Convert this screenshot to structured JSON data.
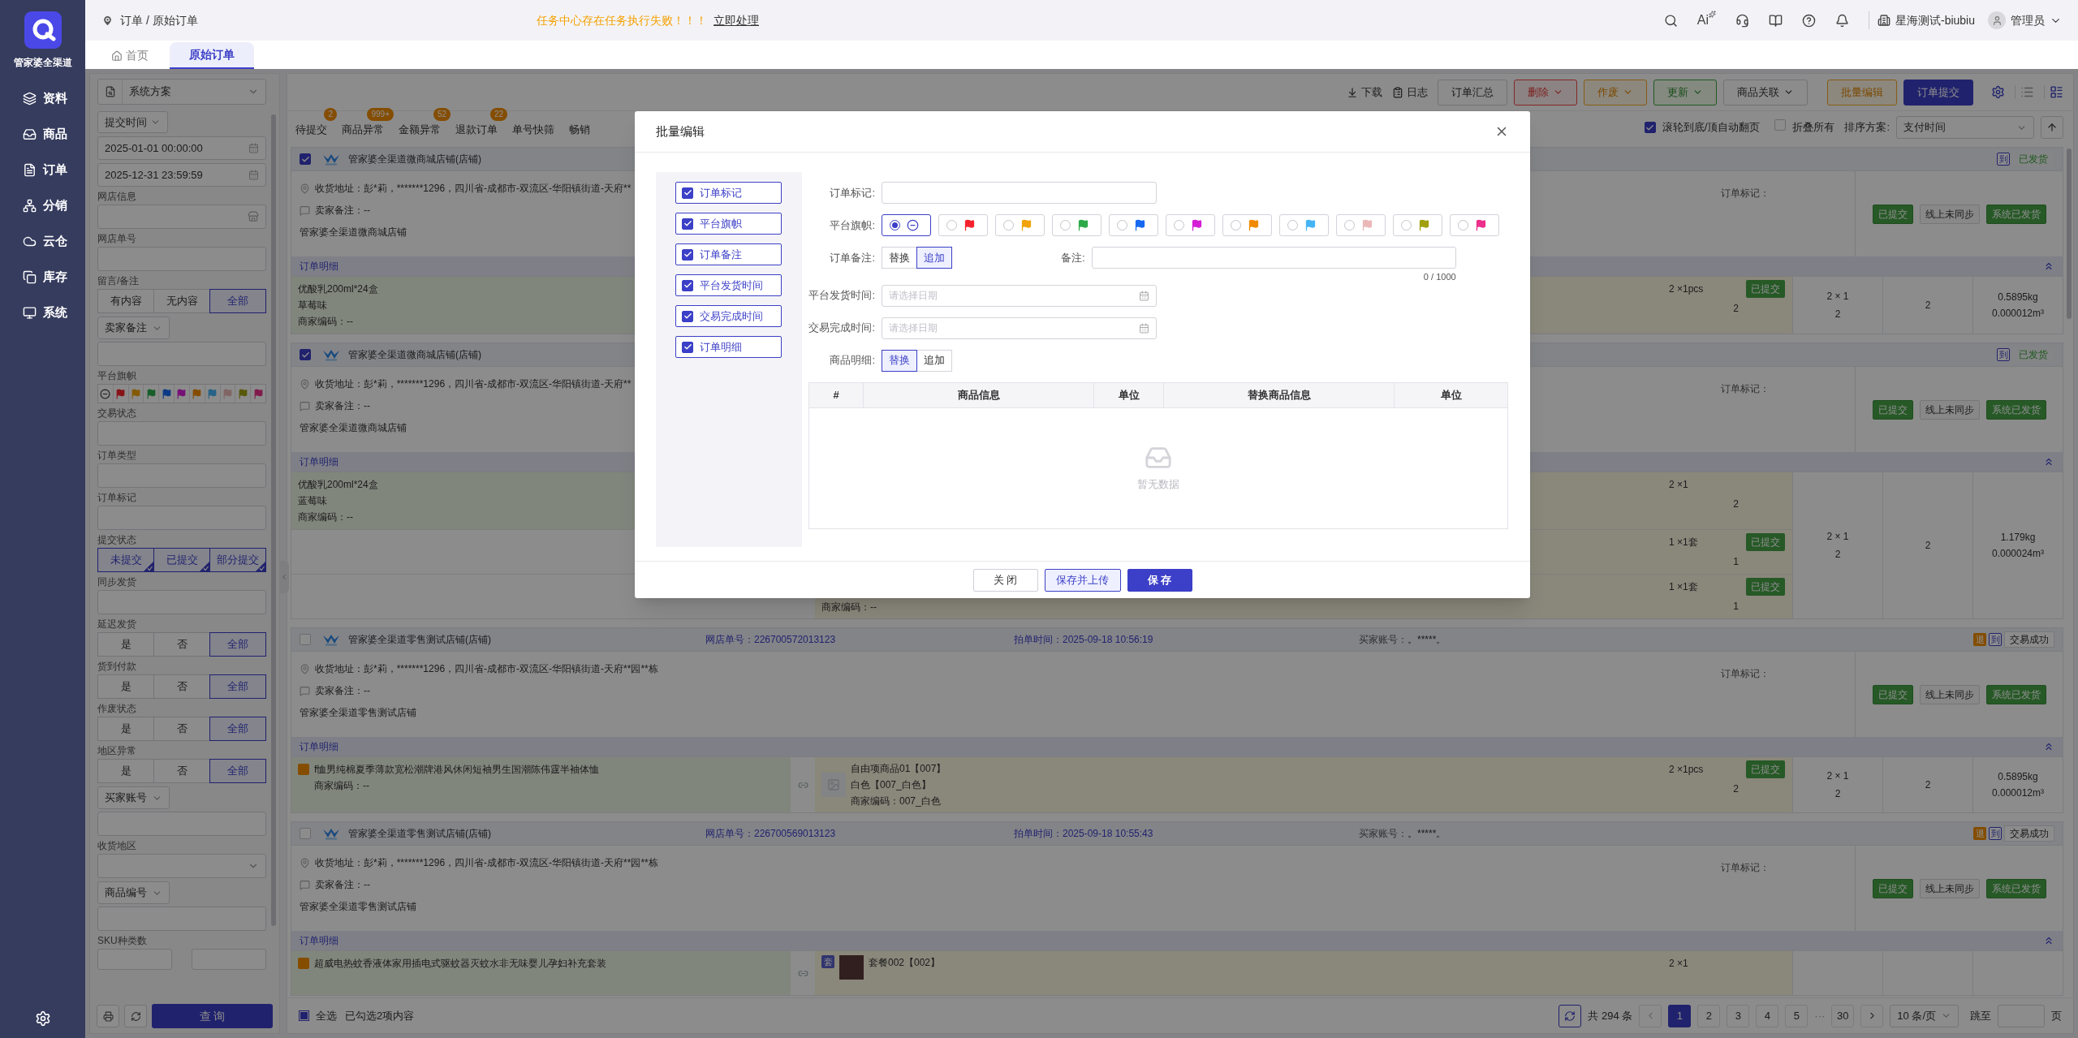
{
  "app": {
    "name": "管家婆全渠道"
  },
  "nav": [
    {
      "label": "资料"
    },
    {
      "label": "商品"
    },
    {
      "label": "订单"
    },
    {
      "label": "分销"
    },
    {
      "label": "云仓"
    },
    {
      "label": "库存"
    },
    {
      "label": "系统"
    }
  ],
  "topbar": {
    "breadcrumb": "订单 / 原始订单",
    "alert": "任务中心存在任务执行失败！！！",
    "alert_action": "立即处理",
    "ai_label": "Ai",
    "company": "星海测试-biubiu",
    "user": "管理员"
  },
  "page_tabs": [
    {
      "label": "首页",
      "selected": false
    },
    {
      "label": "原始订单",
      "selected": true
    }
  ],
  "filters": {
    "scheme": "系统方案",
    "time_type": "提交时间",
    "start": "2025-01-01 00:00:00",
    "end": "2025-12-31 23:59:59",
    "groups": [
      {
        "kind": "store",
        "label": "网店信息"
      },
      {
        "kind": "input",
        "label": "网店单号"
      },
      {
        "kind": "segment",
        "label": "留言/备注",
        "options": [
          {
            "label": "有内容",
            "selected": false
          },
          {
            "label": "无内容",
            "selected": false
          },
          {
            "label": "全部",
            "selected": true
          }
        ]
      },
      {
        "kind": "dropdown",
        "label": "卖家备注"
      },
      {
        "kind": "flags",
        "label": "平台旗帜",
        "flags": [
          {
            "kind": "none"
          },
          {
            "kind": "flag",
            "color": "#871319"
          },
          {
            "kind": "flag",
            "color": "#845a06"
          },
          {
            "kind": "flag",
            "color": "#195e29"
          },
          {
            "kind": "flag",
            "color": "#0c3984"
          },
          {
            "kind": "flag",
            "color": "#761176"
          },
          {
            "kind": "flag",
            "color": "#844c00"
          },
          {
            "kind": "flag",
            "color": "#266387"
          },
          {
            "kind": "flag",
            "color": "#816565"
          },
          {
            "kind": "flag",
            "color": "#585809"
          },
          {
            "kind": "flag",
            "color": "#811a4c"
          }
        ]
      },
      {
        "kind": "input",
        "label": "交易状态"
      },
      {
        "kind": "input",
        "label": "订单类型"
      },
      {
        "kind": "input",
        "label": "订单标记"
      },
      {
        "kind": "multi",
        "label": "提交状态",
        "options": [
          {
            "label": "未提交",
            "selected": true
          },
          {
            "label": "已提交",
            "selected": true
          },
          {
            "label": "部分提交",
            "selected": true
          }
        ]
      },
      {
        "kind": "input",
        "label": "同步发货"
      },
      {
        "kind": "segment",
        "label": "延迟发货",
        "options": [
          {
            "label": "是",
            "selected": false
          },
          {
            "label": "否",
            "selected": false
          },
          {
            "label": "全部",
            "selected": true
          }
        ]
      },
      {
        "kind": "segment",
        "label": "货到付款",
        "options": [
          {
            "label": "是",
            "selected": false
          },
          {
            "label": "否",
            "selected": false
          },
          {
            "label": "全部",
            "selected": true
          }
        ]
      },
      {
        "kind": "segment",
        "label": "作废状态",
        "options": [
          {
            "label": "是",
            "selected": false
          },
          {
            "label": "否",
            "selected": false
          },
          {
            "label": "全部",
            "selected": true
          }
        ]
      },
      {
        "kind": "segment",
        "label": "地区异常",
        "options": [
          {
            "label": "是",
            "selected": false
          },
          {
            "label": "否",
            "selected": false
          },
          {
            "label": "全部",
            "selected": true
          }
        ]
      },
      {
        "kind": "dropdown",
        "label": "买家账号"
      },
      {
        "kind": "select",
        "label": "收货地区"
      },
      {
        "kind": "dropdown",
        "label": "商品编号"
      },
      {
        "kind": "range",
        "label": "SKU种类数"
      }
    ],
    "query": "查 询"
  },
  "toolbar": {
    "links": [
      {
        "label": "下载"
      },
      {
        "label": "日志"
      }
    ],
    "buttons": [
      {
        "label": "订单汇总",
        "kind": "plain",
        "caret": false
      },
      {
        "label": "删除",
        "kind": "red",
        "caret": true
      },
      {
        "label": "作废",
        "kind": "orange",
        "caret": true
      },
      {
        "label": "更新",
        "kind": "green",
        "caret": true
      },
      {
        "label": "商品关联",
        "kind": "plain",
        "caret": true
      },
      {
        "label": "批量编辑",
        "kind": "orange",
        "caret": false
      },
      {
        "label": "订单提交",
        "kind": "primary",
        "caret": false
      }
    ],
    "views": [
      {
        "kind": "list",
        "selected": false
      },
      {
        "kind": "card",
        "selected": true
      }
    ]
  },
  "status_tabs": [
    {
      "label": "待提交",
      "count": "2"
    },
    {
      "label": "商品异常",
      "count": "999+"
    },
    {
      "label": "金额异常",
      "count": "52"
    },
    {
      "label": "退款订单",
      "count": "22"
    },
    {
      "label": "单号快筛"
    },
    {
      "label": "畅销"
    }
  ],
  "list_options": {
    "auto_page": {
      "label": "滚轮到底/顶自动翻页",
      "checked": true
    },
    "collapse_all": {
      "label": "折叠所有",
      "checked": false
    },
    "sort_label": "排序方案:",
    "sort_value": "支付时间"
  },
  "orders": [
    {
      "checked": true,
      "shop": "管家婆全渠道微商城店铺(店铺)",
      "badges": [
        {
          "text": "到",
          "kind": "outline"
        }
      ],
      "status": {
        "text": "已发货",
        "kind": "shipped"
      },
      "address": "收货地址：彭*莉，*******1296，四川省-成都市-双流区-华阳镇街道-天府**",
      "note": "卖家备注：--",
      "shop_line": "管家婆全渠道微商城店铺",
      "mark_label": "订单标记：",
      "actions": [
        {
          "label": "已提交",
          "kind": "green"
        },
        {
          "label": "线上未同步",
          "kind": "plain"
        },
        {
          "label": "系统已发货",
          "kind": "green"
        }
      ],
      "detail": "订单明细",
      "rows": [
        {
          "product": {
            "tagged": false,
            "lines": [
              "优酸乳200ml*24盒",
              "草莓味",
              "商家编码：--"
            ]
          },
          "right": null,
          "qty": "2 ×1pcs",
          "count": "2",
          "state": "已提交"
        }
      ],
      "totals": {
        "qty": "2 × 1",
        "count": "2",
        "sum": "2",
        "weight": "0.5895kg",
        "volume": "0.000012m³"
      }
    },
    {
      "checked": true,
      "shop": "管家婆全渠道微商城店铺(店铺)",
      "badges": [
        {
          "text": "到",
          "kind": "outline"
        }
      ],
      "status": {
        "text": "已发货",
        "kind": "shipped"
      },
      "address": "收货地址：彭*莉，*******1296，四川省-成都市-双流区-华阳镇街道-天府**",
      "note": "卖家备注：--",
      "shop_line": "管家婆全渠道微商城店铺",
      "mark_label": "订单标记：",
      "actions": [
        {
          "label": "已提交",
          "kind": "green"
        },
        {
          "label": "线上未同步",
          "kind": "plain"
        },
        {
          "label": "系统已发货",
          "kind": "green"
        }
      ],
      "detail": "订单明细",
      "rows": [
        {
          "product": {
            "tagged": false,
            "lines": [
              "优酸乳200ml*24盒",
              "蓝莓味",
              "商家编码：--"
            ]
          },
          "right": null,
          "qty": "2 ×1",
          "count": "2"
        },
        {
          "product": null,
          "right": null,
          "qty": "1 ×1套",
          "count": "1",
          "state": "已提交"
        },
        {
          "product": null,
          "right": {
            "lines": [
              "商家编码：--"
            ]
          },
          "qty": "1 ×1套",
          "count": "1",
          "state": "已提交"
        }
      ],
      "totals": {
        "qty": "2 × 1",
        "count": "2",
        "sum": "2",
        "weight": "1.179kg",
        "volume": "0.000024m³"
      }
    },
    {
      "checked": false,
      "shop": "管家婆全渠道零售测试店铺(店铺)",
      "fields": [
        {
          "label": "网店单号：",
          "value": "226700572013123",
          "accent": true
        },
        {
          "label": "拍单时间：",
          "value": "2025-09-18 10:56:19",
          "accent": true
        },
        {
          "label": "买家账号：",
          "value": "。*****。",
          "accent": false
        }
      ],
      "badges": [
        {
          "text": "退",
          "kind": "filled"
        },
        {
          "text": "到",
          "kind": "outline"
        }
      ],
      "status": {
        "text": "交易成功",
        "kind": "done"
      },
      "address": "收货地址：彭*莉，*******1296，四川省-成都市-双流区-华阳镇街道-天府**园**栋",
      "note": "卖家备注：--",
      "shop_line": "管家婆全渠道零售测试店铺",
      "mark_label": "订单标记：",
      "actions": [
        {
          "label": "已提交",
          "kind": "green"
        },
        {
          "label": "线上未同步",
          "kind": "plain"
        },
        {
          "label": "系统已发货",
          "kind": "green"
        }
      ],
      "detail": "订单明细",
      "rows": [
        {
          "product": {
            "tagged": true,
            "lines": [
              "f恤男纯棉夏季薄款宽松潮牌港风休闲短袖男生国潮陈伟霆半袖体恤",
              "商家编码：--"
            ]
          },
          "right": {
            "kind": "placeholder",
            "lines": [
              "自由项商品01【007】",
              "白色【007_白色】",
              "商家编码：007_白色"
            ]
          },
          "qty": "2 ×1pcs",
          "count": "2",
          "state": "已提交"
        }
      ],
      "totals": {
        "qty": "2 × 1",
        "count": "2",
        "sum": "2",
        "weight": "0.5895kg",
        "volume": "0.000012m³"
      }
    },
    {
      "checked": false,
      "shop": "管家婆全渠道零售测试店铺(店铺)",
      "fields": [
        {
          "label": "网店单号：",
          "value": "226700569013123",
          "accent": true
        },
        {
          "label": "拍单时间：",
          "value": "2025-09-18 10:55:43",
          "accent": true
        },
        {
          "label": "买家账号：",
          "value": "。*****。",
          "accent": false
        }
      ],
      "badges": [
        {
          "text": "退",
          "kind": "filled"
        },
        {
          "text": "到",
          "kind": "outline"
        }
      ],
      "status": {
        "text": "交易成功",
        "kind": "done"
      },
      "address": "收货地址：彭*莉，*******1296，四川省-成都市-双流区-华阳镇街道-天府**园**栋",
      "note": "卖家备注：--",
      "shop_line": "管家婆全渠道零售测试店铺",
      "mark_label": "订单标记：",
      "actions": [
        {
          "label": "已提交",
          "kind": "green"
        },
        {
          "label": "线上未同步",
          "kind": "plain"
        },
        {
          "label": "系统已发货",
          "kind": "green"
        }
      ],
      "detail": "订单明细",
      "rows": [
        {
          "product": {
            "tagged": true,
            "lines": [
              "超威电热蚊香液体家用插电式驱蚊器灭蚊水非无味婴儿孕妇补充套装"
            ]
          },
          "right": {
            "kind": "photo",
            "set_tag": "套",
            "lines": [
              "套餐002【002】"
            ]
          },
          "qty": "2 ×1"
        }
      ]
    }
  ],
  "footer": {
    "select_all": {
      "label": "全选",
      "partial": true
    },
    "selected_text": "已勾选2项内容",
    "total": "共 294 条",
    "pages": [
      {
        "label": "1",
        "kind": "page",
        "selected": true
      },
      {
        "label": "2",
        "kind": "page",
        "selected": false
      },
      {
        "label": "3",
        "kind": "page",
        "selected": false
      },
      {
        "label": "4",
        "kind": "page",
        "selected": false
      },
      {
        "label": "5",
        "kind": "page",
        "selected": false
      },
      {
        "label": "···",
        "kind": "ellipsis",
        "selected": false
      },
      {
        "label": "30",
        "kind": "page",
        "selected": false
      }
    ],
    "page_size": "10 条/页",
    "jump_label": "跳至",
    "page_unit": "页"
  },
  "dialog": {
    "title": "批量编辑",
    "fields": [
      {
        "label": "订单标记",
        "checked": true
      },
      {
        "label": "平台旗帜",
        "checked": true
      },
      {
        "label": "订单备注",
        "checked": true
      },
      {
        "label": "平台发货时间",
        "checked": true
      },
      {
        "label": "交易完成时间",
        "checked": true
      },
      {
        "label": "订单明细",
        "checked": true
      }
    ],
    "mark_label": "订单标记:",
    "flag_label": "平台旗帜:",
    "flags": [
      {
        "kind": "none",
        "selected": true
      },
      {
        "kind": "flag",
        "color": "#f5222d",
        "selected": false
      },
      {
        "kind": "flag",
        "color": "#f0a30a",
        "selected": false
      },
      {
        "kind": "flag",
        "color": "#2eaa4a",
        "selected": false
      },
      {
        "kind": "flag",
        "color": "#1668f0",
        "selected": false
      },
      {
        "kind": "flag",
        "color": "#d61ed6",
        "selected": false
      },
      {
        "kind": "flag",
        "color": "#f08a00",
        "selected": false
      },
      {
        "kind": "flag",
        "color": "#45b4f5",
        "selected": false
      },
      {
        "kind": "flag",
        "color": "#ebb8b8",
        "selected": false
      },
      {
        "kind": "flag",
        "color": "#a0a010",
        "selected": false
      },
      {
        "kind": "flag",
        "color": "#eb2f8a",
        "selected": false
      }
    ],
    "note_label": "订单备注:",
    "note_modes": [
      {
        "label": "替换",
        "selected": false
      },
      {
        "label": "追加",
        "selected": true
      }
    ],
    "remark_label": "备注:",
    "remark_count": "0 / 1000",
    "ship_label": "平台发货时间:",
    "ship_placeholder": "请选择日期",
    "finish_label": "交易完成时间:",
    "finish_placeholder": "请选择日期",
    "detail_label": "商品明细:",
    "detail_modes": [
      {
        "label": "替换",
        "selected": true
      },
      {
        "label": "追加",
        "selected": false
      }
    ],
    "table": {
      "columns": [
        "#",
        "商品信息",
        "单位",
        "替换商品信息",
        "单位"
      ],
      "empty": "暂无数据"
    },
    "buttons": [
      {
        "label": "关 闭",
        "kind": "plain"
      },
      {
        "label": "保存并上传",
        "kind": "outline"
      },
      {
        "label": "保 存",
        "kind": "primary"
      }
    ]
  }
}
